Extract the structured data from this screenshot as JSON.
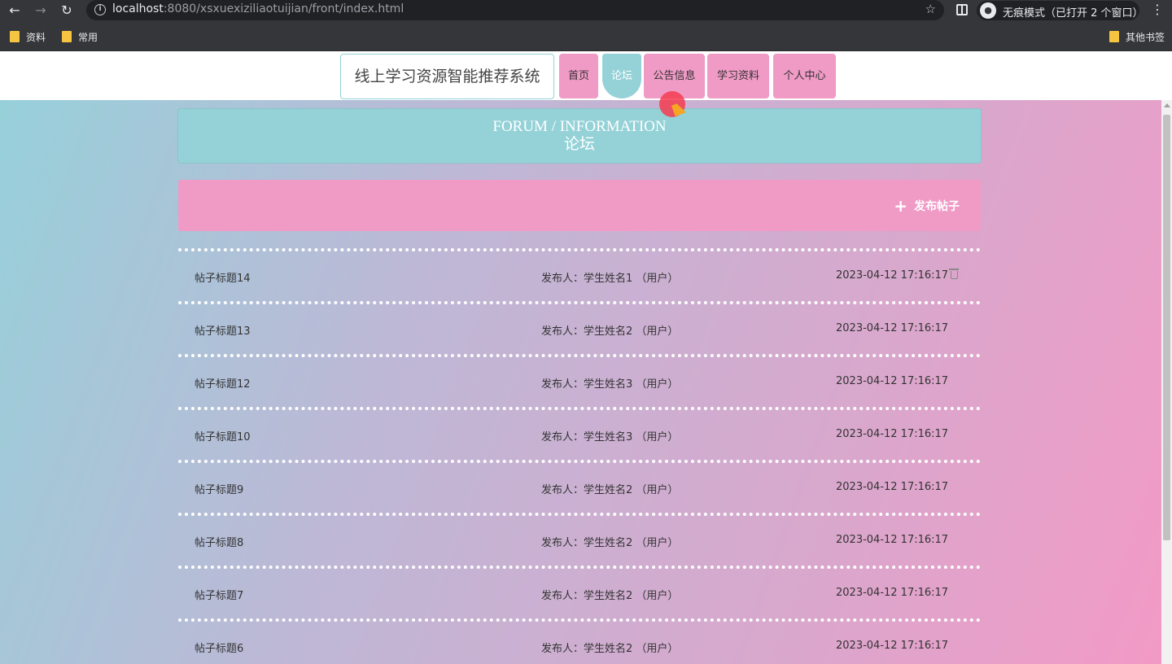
{
  "browser": {
    "url_host": "localhost",
    "url_rest": ":8080/xsxuexiziliaotuijian/front/index.html",
    "incognito_label": "无痕模式（已打开 2 个窗口）",
    "bookmarks": [
      "资料",
      "常用"
    ],
    "other_bookmarks": "其他书签"
  },
  "site": {
    "title": "线上学习资源智能推荐系统",
    "nav": [
      {
        "label": "首页",
        "active": false
      },
      {
        "label": "论坛",
        "active": true
      },
      {
        "label": "公告信息",
        "active": false
      },
      {
        "label": "学习资料",
        "active": false
      },
      {
        "label": "个人中心",
        "active": false
      }
    ]
  },
  "banner": {
    "en": "FORUM / INFORMATION",
    "cn": "论坛"
  },
  "actions": {
    "publish_label": "发布帖子"
  },
  "posts": [
    {
      "title": "帖子标题14",
      "author": "发布人：学生姓名1 （用户）",
      "date": "2023-04-12 17:16:17",
      "deletable": true
    },
    {
      "title": "帖子标题13",
      "author": "发布人：学生姓名2 （用户）",
      "date": "2023-04-12 17:16:17",
      "deletable": false
    },
    {
      "title": "帖子标题12",
      "author": "发布人：学生姓名3 （用户）",
      "date": "2023-04-12 17:16:17",
      "deletable": false
    },
    {
      "title": "帖子标题10",
      "author": "发布人：学生姓名3 （用户）",
      "date": "2023-04-12 17:16:17",
      "deletable": false
    },
    {
      "title": "帖子标题9",
      "author": "发布人：学生姓名2 （用户）",
      "date": "2023-04-12 17:16:17",
      "deletable": false
    },
    {
      "title": "帖子标题8",
      "author": "发布人：学生姓名2 （用户）",
      "date": "2023-04-12 17:16:17",
      "deletable": false
    },
    {
      "title": "帖子标题7",
      "author": "发布人：学生姓名2 （用户）",
      "date": "2023-04-12 17:16:17",
      "deletable": false
    },
    {
      "title": "帖子标题6",
      "author": "发布人：学生姓名2 （用户）",
      "date": "2023-04-12 17:16:17",
      "deletable": false
    }
  ],
  "colors": {
    "teal": "#94d2d8",
    "pink": "#f09ac6"
  }
}
